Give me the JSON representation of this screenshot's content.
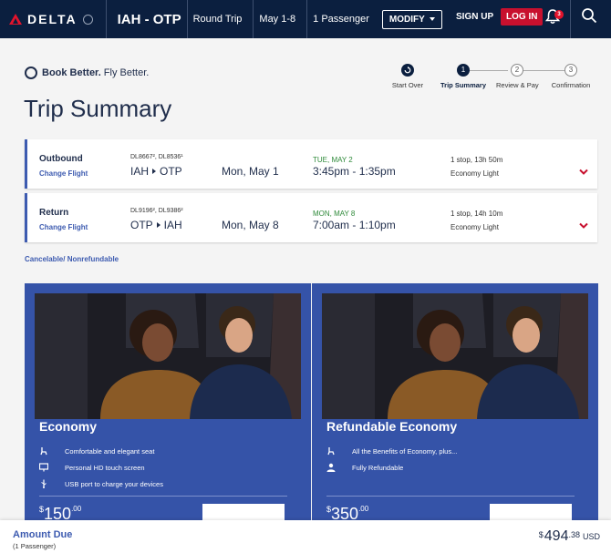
{
  "header": {
    "logo_text": "DELTA",
    "route": "IAH - OTP",
    "trip_type": "Round Trip",
    "dates": "May 1-8",
    "passengers": "1 Passenger",
    "modify_label": "MODIFY",
    "signup_label": "SIGN UP",
    "login_label": "LOG IN",
    "notification_count": "3"
  },
  "tagline": {
    "bold": "Book Better.",
    "rest": "Fly Better."
  },
  "steps": [
    {
      "number": "",
      "label": "Start Over"
    },
    {
      "number": "1",
      "label": "Trip Summary"
    },
    {
      "number": "2",
      "label": "Review & Pay"
    },
    {
      "number": "3",
      "label": "Confirmation"
    }
  ],
  "page_title": "Trip Summary",
  "flights": [
    {
      "type": "Outbound",
      "change_label": "Change Flight",
      "flight_numbers": "DL8667², DL8536¹",
      "origin": "IAH",
      "destination": "OTP",
      "date": "Mon, May 1",
      "day_label": "TUE, MAY 2",
      "times": "3:45pm - 1:35pm",
      "stops": "1 stop, 13h 50m",
      "fare_class": "Economy Light"
    },
    {
      "type": "Return",
      "change_label": "Change Flight",
      "flight_numbers": "DL9196², DL9386²",
      "origin": "OTP",
      "destination": "IAH",
      "date": "Mon, May 8",
      "day_label": "MON, MAY 8",
      "times": "7:00am - 1:10pm",
      "stops": "1 stop, 14h 10m",
      "fare_class": "Economy Light"
    }
  ],
  "policy": "Cancelable/ Nonrefundable",
  "fares": [
    {
      "name": "Economy",
      "features": [
        {
          "icon": "seat-icon",
          "text": "Comfortable and elegant seat"
        },
        {
          "icon": "screen-icon",
          "text": "Personal HD touch screen"
        },
        {
          "icon": "usb-icon",
          "text": "USB port to charge your devices"
        }
      ],
      "price_dollars": "150",
      "price_cents": ".00"
    },
    {
      "name": "Refundable Economy",
      "features": [
        {
          "icon": "seat-icon",
          "text": "All the Benefits of Economy, plus..."
        },
        {
          "icon": "person-icon",
          "text": "Fully Refundable"
        }
      ],
      "price_dollars": "350",
      "price_cents": ".00"
    }
  ],
  "amount_due": {
    "label": "Amount Due",
    "sub": "(1 Passenger)",
    "currency": "$",
    "dollars": "494",
    "cents": ".38",
    "code": "USD"
  },
  "colors": {
    "navy": "#0b1f3f",
    "brand_red": "#c8102e",
    "accent_blue": "#3553a8",
    "green": "#2f8a3a"
  }
}
